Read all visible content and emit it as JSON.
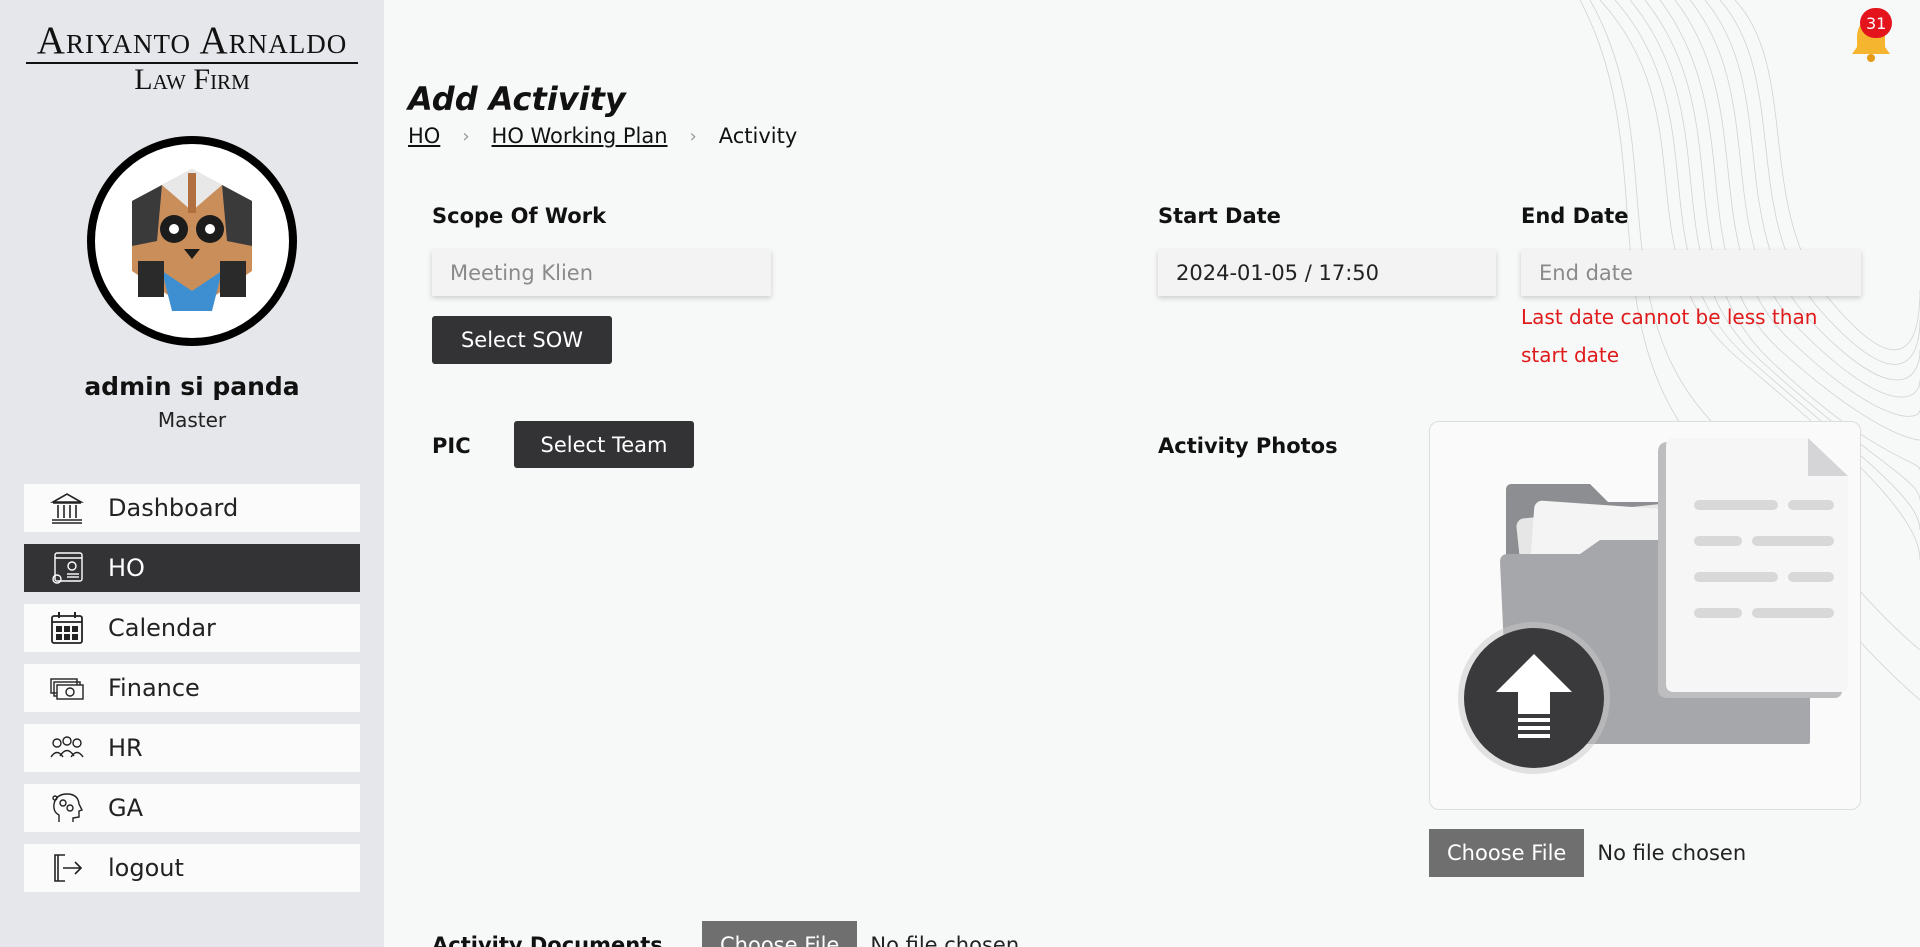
{
  "brand": {
    "name": "Ariyanto Arnaldo",
    "subtitle": "Law Firm"
  },
  "user": {
    "name": "admin si panda",
    "role": "Master"
  },
  "sidebar": {
    "items": [
      {
        "label": "Dashboard",
        "icon": "bank-icon",
        "active": false
      },
      {
        "label": "HO",
        "icon": "office-gear-icon",
        "active": true
      },
      {
        "label": "Calendar",
        "icon": "calendar-icon",
        "active": false
      },
      {
        "label": "Finance",
        "icon": "money-icon",
        "active": false
      },
      {
        "label": "HR",
        "icon": "people-icon",
        "active": false
      },
      {
        "label": "GA",
        "icon": "head-gears-icon",
        "active": false
      },
      {
        "label": "logout",
        "icon": "logout-icon",
        "active": false
      }
    ]
  },
  "notifications": {
    "count": "31"
  },
  "page": {
    "title": "Add Activity",
    "breadcrumb": [
      {
        "label": "HO",
        "link": true
      },
      {
        "label": "HO Working Plan",
        "link": true
      },
      {
        "label": "Activity",
        "link": false
      }
    ],
    "breadcrumb_sep": "›"
  },
  "form": {
    "scope_label": "Scope Of Work",
    "scope_placeholder": "Meeting Klien",
    "select_sow": "Select SOW",
    "start_label": "Start Date",
    "start_value": "2024-01-05 / 17:50",
    "end_label": "End Date",
    "end_placeholder": "End date",
    "end_error": "Last date cannot be less than start date",
    "pic_label": "PIC",
    "select_team": "Select Team",
    "photos_label": "Activity Photos",
    "photos_choose": "Choose File",
    "photos_status": "No file chosen",
    "docs_label": "Activity Documents",
    "docs_choose": "Choose File",
    "docs_status": "No file chosen"
  },
  "colors": {
    "accent_dark": "#333336",
    "error": "#e01b1b",
    "badge": "#e4141c"
  }
}
